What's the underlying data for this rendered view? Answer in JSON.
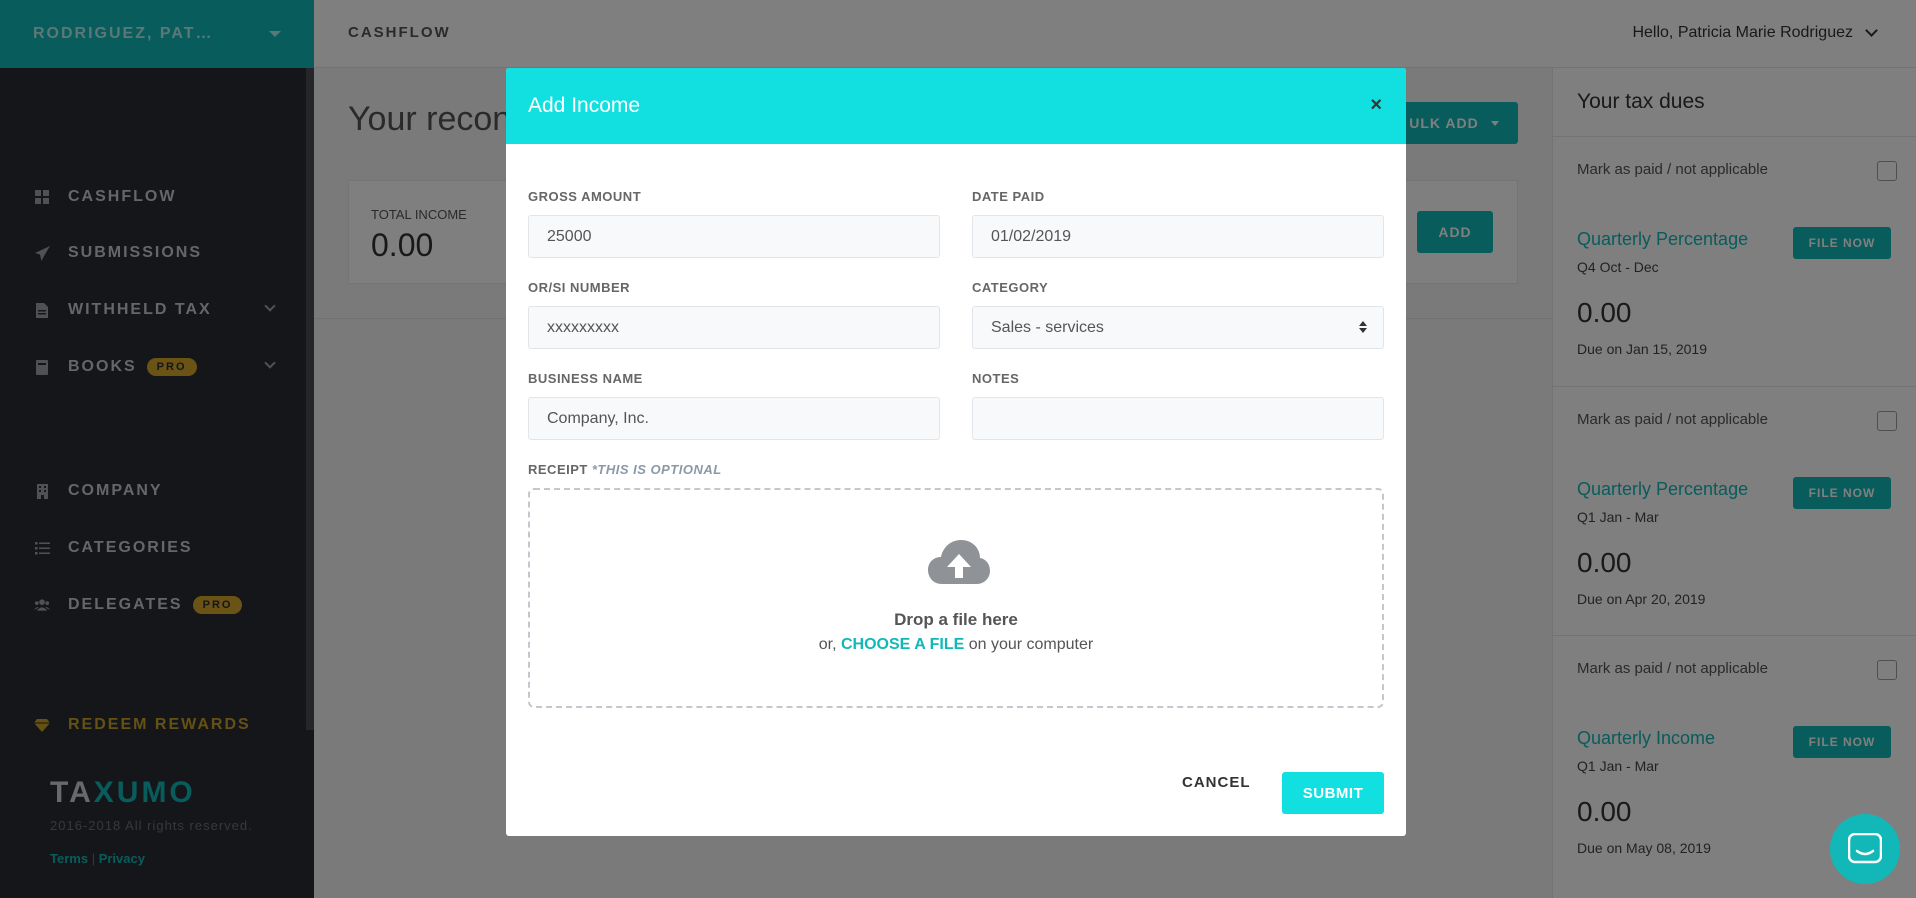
{
  "sidebar": {
    "account_name": "RODRIGUEZ, PAT…",
    "items": [
      {
        "label": "CASHFLOW"
      },
      {
        "label": "SUBMISSIONS"
      },
      {
        "label": "WITHHELD TAX"
      },
      {
        "label": "BOOKS",
        "badge": "PRO"
      },
      {
        "label": "COMPANY"
      },
      {
        "label": "CATEGORIES"
      },
      {
        "label": "DELEGATES",
        "badge": "PRO"
      }
    ],
    "rewards_label": "REDEEM REWARDS",
    "logo_left": "TA",
    "logo_x": "X",
    "logo_right": "UMO",
    "copyright": "2016-2018 All rights reserved.",
    "terms": "Terms",
    "privacy": "Privacy"
  },
  "topbar": {
    "title": "CASHFLOW",
    "greeting": "Hello, Patricia Marie Rodriguez"
  },
  "main": {
    "heading": "Your recon",
    "bulk_add": "ULK ADD",
    "total_income_label": "TOTAL INCOME",
    "total_income_value": "0.00",
    "add_label": "ADD"
  },
  "tax_panel": {
    "title": "Your tax dues",
    "cards": [
      {
        "mark": "Mark as paid / not applicable",
        "name": "Quarterly Percentage",
        "file": "FILE NOW",
        "period": "Q4 Oct - Dec",
        "amount": "0.00",
        "due": "Due on Jan 15, 2019"
      },
      {
        "mark": "Mark as paid / not applicable",
        "name": "Quarterly Percentage",
        "file": "FILE NOW",
        "period": "Q1 Jan - Mar",
        "amount": "0.00",
        "due": "Due on Apr 20, 2019"
      },
      {
        "mark": "Mark as paid / not applicable",
        "name": "Quarterly Income",
        "file": "FILE NOW",
        "period": "Q1 Jan - Mar",
        "amount": "0.00",
        "due": "Due on May 08, 2019"
      }
    ]
  },
  "modal": {
    "title": "Add Income",
    "close": "×",
    "gross_amount_label": "GROSS AMOUNT",
    "gross_amount_value": "25000",
    "date_paid_label": "DATE PAID",
    "date_paid_value": "01/02/2019",
    "or_si_label": "OR/SI NUMBER",
    "or_si_value": "xxxxxxxxx",
    "category_label": "CATEGORY",
    "category_value": "Sales - services",
    "business_name_label": "BUSINESS NAME",
    "business_name_value": "Company, Inc.",
    "notes_label": "NOTES",
    "notes_value": "",
    "receipt_label": "RECEIPT",
    "receipt_optional": "*THIS IS OPTIONAL",
    "drop_title": "Drop a file here",
    "drop_prefix": "or,",
    "drop_choose": "CHOOSE A FILE",
    "drop_suffix": "on your computer",
    "cancel": "CANCEL",
    "submit": "SUBMIT"
  },
  "colors": {
    "brand": "#12b8b8",
    "modal_header": "#12e0e0",
    "sidebar_bg": "#2b2d33",
    "pro_badge": "#d6a72a"
  }
}
